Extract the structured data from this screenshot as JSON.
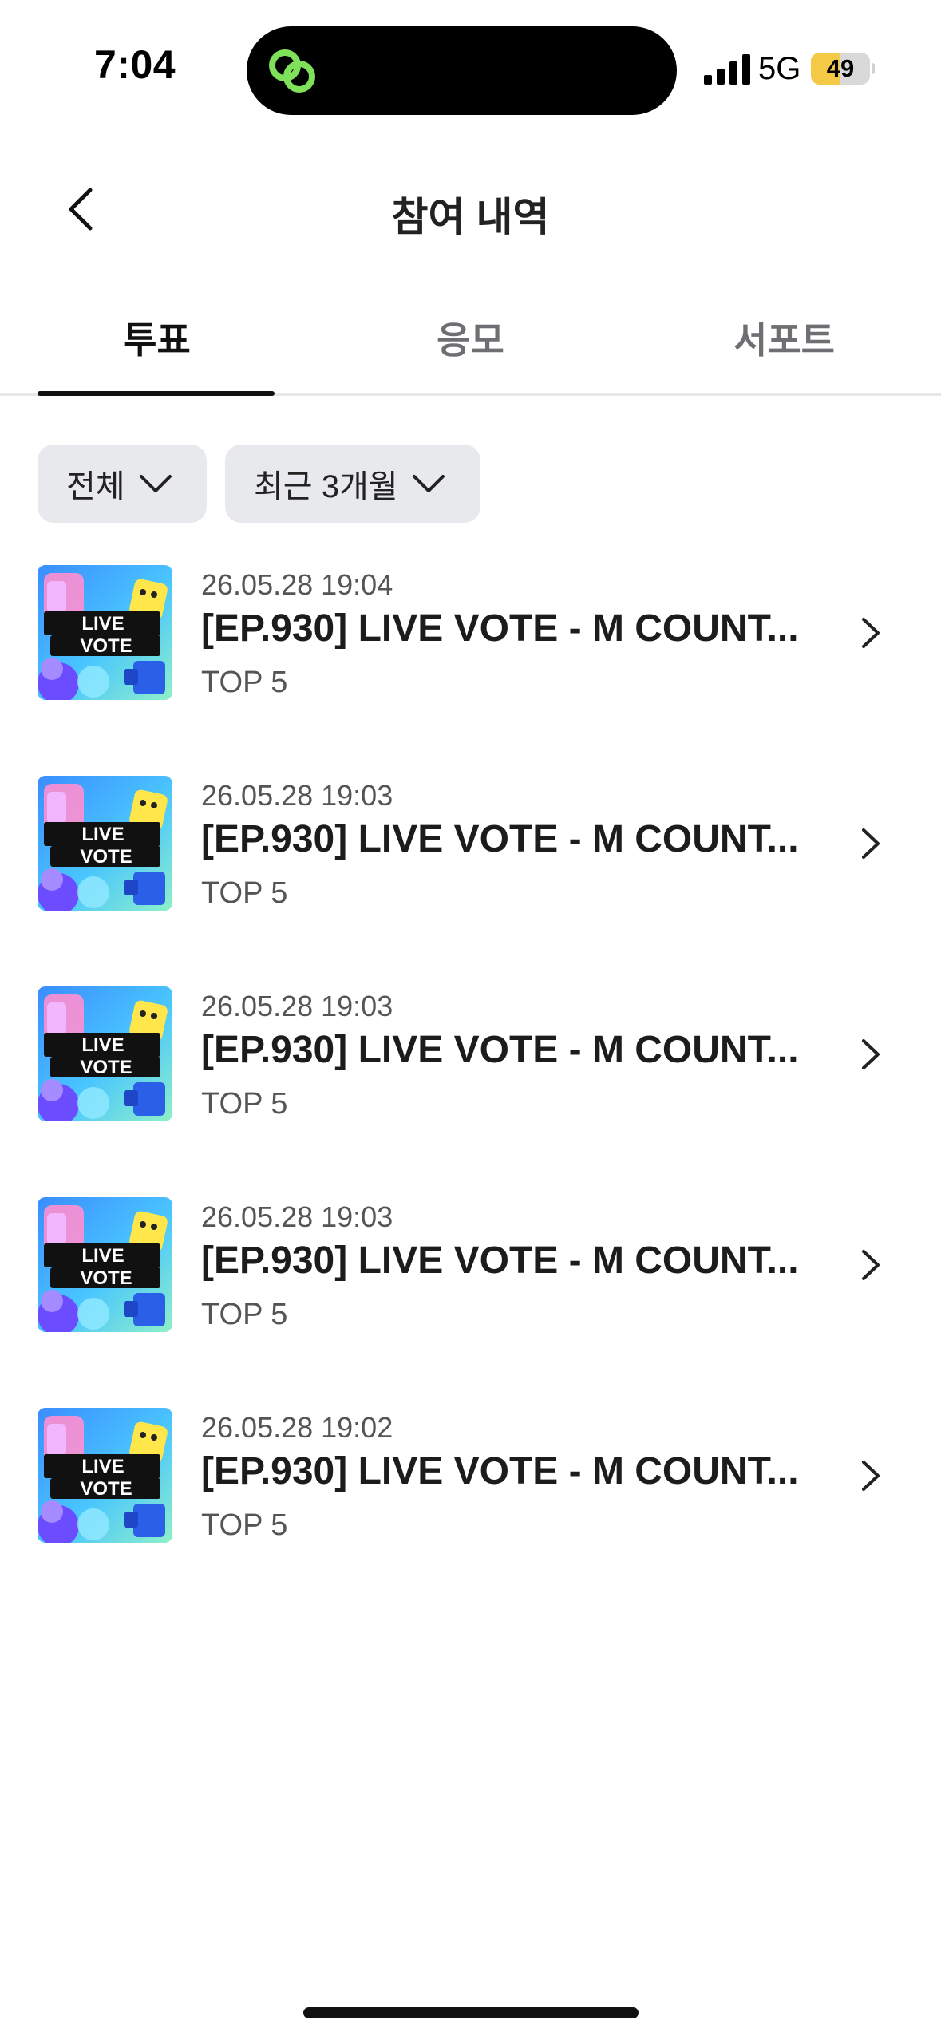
{
  "status_bar": {
    "time": "7:04",
    "network": "5G",
    "battery_level": "49",
    "battery_fraction": 0.49,
    "battery_color": "#f4c945",
    "island_app_icon": "green-link-icon"
  },
  "header": {
    "title": "참여 내역",
    "back_icon": "chevron-left-icon"
  },
  "tabs": [
    {
      "label": "투표",
      "active": true
    },
    {
      "label": "응모",
      "active": false
    },
    {
      "label": "서포트",
      "active": false
    }
  ],
  "filters": {
    "type": "전체",
    "period": "최근 3개월"
  },
  "items": [
    {
      "date": "26.05.28 19:04",
      "title": "[EP.930] LIVE VOTE - M COUNT...",
      "subtitle": "TOP 5",
      "thumbnail": "live-vote-thumbnail",
      "thumb_text_1": "LIVE",
      "thumb_text_2": "VOTE"
    },
    {
      "date": "26.05.28 19:03",
      "title": "[EP.930] LIVE VOTE - M COUNT...",
      "subtitle": "TOP 5",
      "thumbnail": "live-vote-thumbnail",
      "thumb_text_1": "LIVE",
      "thumb_text_2": "VOTE"
    },
    {
      "date": "26.05.28 19:03",
      "title": "[EP.930] LIVE VOTE - M COUNT...",
      "subtitle": "TOP 5",
      "thumbnail": "live-vote-thumbnail",
      "thumb_text_1": "LIVE",
      "thumb_text_2": "VOTE"
    },
    {
      "date": "26.05.28 19:03",
      "title": "[EP.930] LIVE VOTE - M COUNT...",
      "subtitle": "TOP 5",
      "thumbnail": "live-vote-thumbnail",
      "thumb_text_1": "LIVE",
      "thumb_text_2": "VOTE"
    },
    {
      "date": "26.05.28 19:02",
      "title": "[EP.930] LIVE VOTE - M COUNT...",
      "subtitle": "TOP 5",
      "thumbnail": "live-vote-thumbnail",
      "thumb_text_1": "LIVE",
      "thumb_text_2": "VOTE"
    }
  ]
}
